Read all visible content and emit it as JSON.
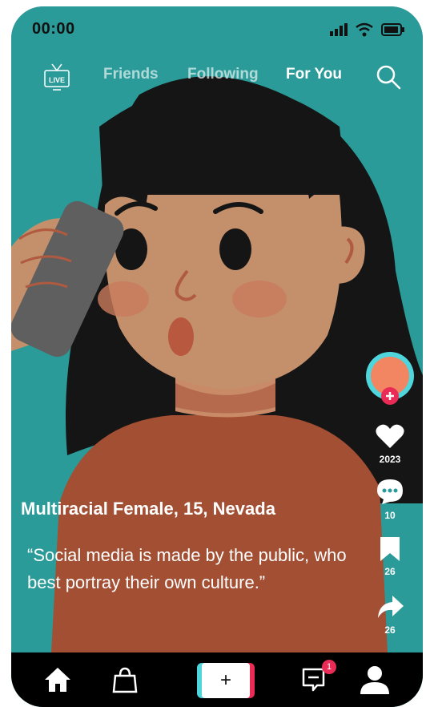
{
  "status_bar": {
    "time": "00:00"
  },
  "top_nav": {
    "live_label": "LIVE",
    "tabs": [
      {
        "label": "Friends"
      },
      {
        "label": "Following"
      },
      {
        "label": "For You",
        "active": true
      }
    ]
  },
  "side_actions": {
    "likes": "2023",
    "comments": "10",
    "saves": "26",
    "shares": "26"
  },
  "caption": {
    "name": "Multiracial Female, 15, Nevada",
    "quote": "“Social media is made by the public, who best portray their own culture.”"
  },
  "bottom_bar": {
    "create_label": "+",
    "inbox_badge": "1"
  },
  "colors": {
    "background": "#2b9b99",
    "accent_pink": "#ea2b55",
    "accent_cyan": "#4fd6dc",
    "hair": "#151515",
    "skin": "#c4906b",
    "shirt": "#a34f33"
  }
}
